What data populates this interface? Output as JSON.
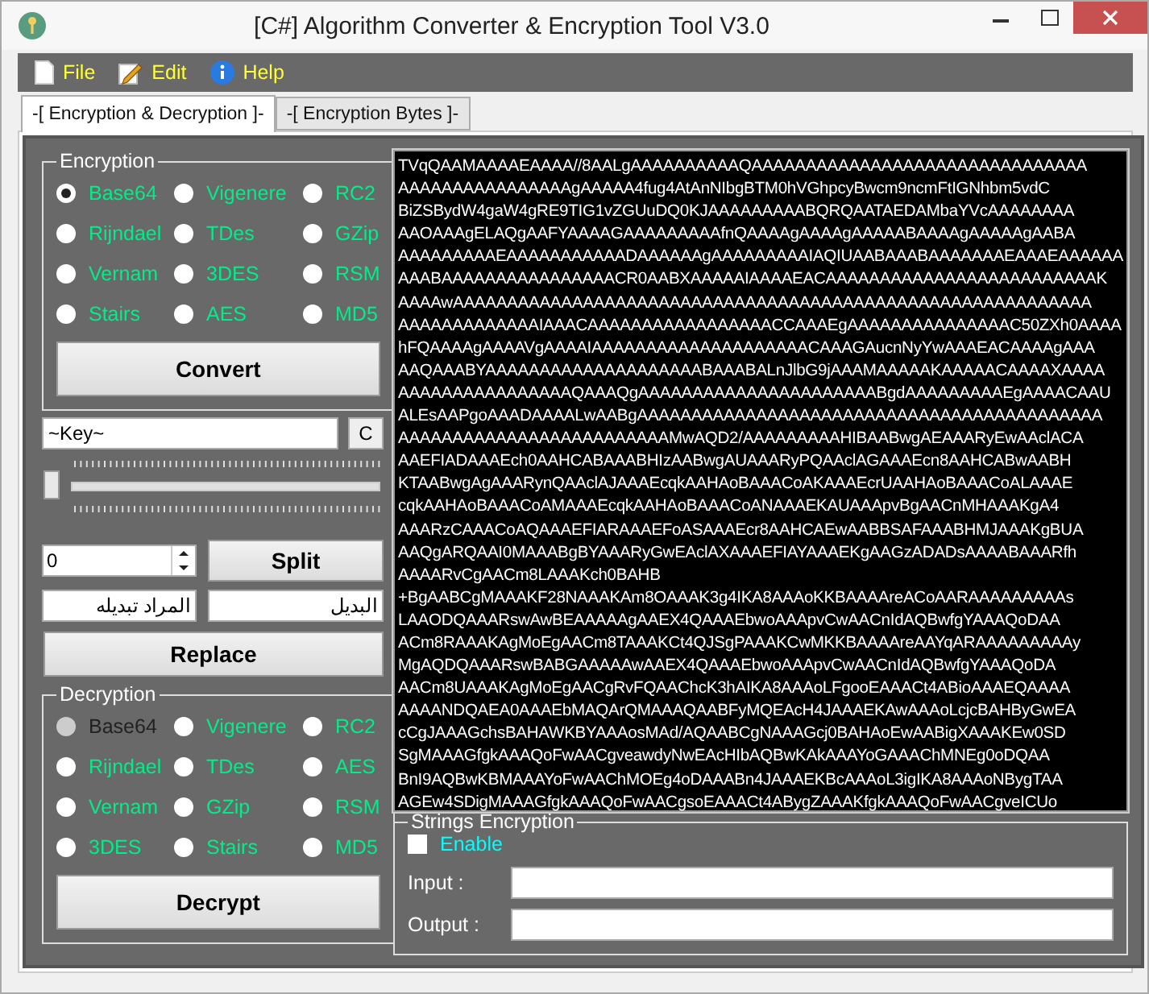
{
  "window": {
    "title": "[C#] Algorithm Converter & Encryption Tool V3.0"
  },
  "menu": [
    {
      "label": "File",
      "kind": "file"
    },
    {
      "label": "Edit",
      "kind": "edit"
    },
    {
      "label": "Help",
      "kind": "help"
    }
  ],
  "tabs": [
    {
      "label": "-[ Encryption & Decryption ]-",
      "selected": true
    },
    {
      "label": "-[ Encryption Bytes ]-",
      "selected": false
    }
  ],
  "encryption": {
    "title": "Encryption",
    "button": "Convert",
    "options": [
      {
        "label": "Base64",
        "selected": true,
        "disabled": false
      },
      {
        "label": "Vigenere",
        "selected": false,
        "disabled": false
      },
      {
        "label": "RC2",
        "selected": false,
        "disabled": false
      },
      {
        "label": "Rijndael",
        "selected": false,
        "disabled": false
      },
      {
        "label": "TDes",
        "selected": false,
        "disabled": false
      },
      {
        "label": "GZip",
        "selected": false,
        "disabled": false
      },
      {
        "label": "Vernam",
        "selected": false,
        "disabled": false
      },
      {
        "label": "3DES",
        "selected": false,
        "disabled": false
      },
      {
        "label": "RSM",
        "selected": false,
        "disabled": false
      },
      {
        "label": "Stairs",
        "selected": false,
        "disabled": false
      },
      {
        "label": "AES",
        "selected": false,
        "disabled": false
      },
      {
        "label": "MD5",
        "selected": false,
        "disabled": false
      }
    ]
  },
  "key": {
    "value": "~Key~",
    "button": "C"
  },
  "slider": {
    "level": 0
  },
  "split": {
    "value": "0",
    "button": "Split"
  },
  "replace": {
    "find": "المراد تبديله",
    "with": "البديل",
    "button": "Replace"
  },
  "decryption": {
    "title": "Decryption",
    "button": "Decrypt",
    "options": [
      {
        "label": "Base64",
        "selected": false,
        "disabled": true
      },
      {
        "label": "Vigenere",
        "selected": false,
        "disabled": false
      },
      {
        "label": "RC2",
        "selected": false,
        "disabled": false
      },
      {
        "label": "Rijndael",
        "selected": false,
        "disabled": false
      },
      {
        "label": "TDes",
        "selected": false,
        "disabled": false
      },
      {
        "label": "AES",
        "selected": false,
        "disabled": false
      },
      {
        "label": "Vernam",
        "selected": false,
        "disabled": false
      },
      {
        "label": "GZip",
        "selected": false,
        "disabled": false
      },
      {
        "label": "RSM",
        "selected": false,
        "disabled": false
      },
      {
        "label": "3DES",
        "selected": false,
        "disabled": false
      },
      {
        "label": "Stairs",
        "selected": false,
        "disabled": false
      },
      {
        "label": "MD5",
        "selected": false,
        "disabled": false
      }
    ]
  },
  "output": {
    "lines": [
      "TVqQAAMAAAAEAAAA//8AALgAAAAAAAAAAQAAAAAAAAAAAAAAAAAAAAAAAAAAAAAAA",
      "AAAAAAAAAAAAAAAAgAAAAA4fug4AtAnNIbgBTM0hVGhpcyBwcm9ncmFtIGNhbm5vdC",
      "BiZSBydW4gaW4gRE9TIG1vZGUuDQ0KJAAAAAAAAABQRQAATAEDAMbaYVcAAAAAAAA",
      "AAOAAAgELAQgAAFYAAAAGAAAAAAAAAfnQAAAAgAAAAgAAAAABAAAAgAAAAAgAABA",
      "AAAAAAAAAEAAAAAAAAAAADAAAAAAgAAAAAAAAAIAQIUAABAAABAAAAAAAEAAAEAAAAAA",
      "AAABAAAAAAAAAAAAAAAACR0AABXAAAAAIAAAAEACAAAAAAAAAAAAAAAAAAAAAAAAAK",
      "AAAAwAAAAAAAAAAAAAAAAAAAAAAAAAAAAAAAAAAAAAAAAAAAAAAAAAAAAAAAAAAA",
      "AAAAAAAAAAAAAIAAACAAAAAAAAAAAAAAAAACCAAAEgAAAAAAAAAAAAAAAC50ZXh0AAAA",
      "hFQAAAAgAAAAVgAAAAIAAAAAAAAAAAAAAAAAAAACAAAGAucnNyYwAAAEACAAAAgAAA",
      "AAQAAABYAAAAAAAAAAAAAAAAAAAABAAABALnJlbG9jAAAMAAAAAKAAAAACAAAAXAAAA",
      "AAAAAAAAAAAAAAAAQAAAQgAAAAAAAAAAAAAAAAAAAAAABgdAAAAAAAAAEgAAAACAAU",
      "ALEsAAPgoAAADAAAALwAABgAAAAAAAAAAAAAAAAAAAAAAAAAAAAAAAAAAAAAAAAAAA",
      "AAAAAAAAAAAAAAAAAAAAAAAAAMwAQD2/AAAAAAAAAHIBAABwgAEAAARyEwAAclACA",
      "AAEFIADAAAEch0AAHCABAAABHIzAABwgAUAAARyPQAAclAGAAAEcn8AAHCABwAABH",
      "KTAABwgAgAAARynQAAclAJAAAEcqkAAHAoBAAACoAKAAAEcrUAAHAoBAAACoALAAAE",
      "cqkAAHAoBAAACoAMAAAEcqkAAHAoBAAACoANAAAEKAUAAApvBgAACnMHAAAKgA4",
      "AAARzCAAACoAQAAAEFIARAAAEFoASAAAEcr8AAHCAEwAABBSAFAAABHMJAAAKgBUA",
      "AAQgARQAAI0MAAABgBYAAARyGwEAclAXAAAEFIAYAAAEKgAAGzADADsAAAABAAARfh",
      "AAAARvCgAACm8LAAAKch0BAHB",
      "+BgAABCgMAAAKF28NAAAKAm8OAAAK3g4IKA8AAAoKKBAAAAreACoAARAAAAAAAAAs",
      "LAAODQAAARswAwBEAAAAAgAAEX4QAAAEbwoAAApvCwAACnIdAQBwfgYAAAQoDAA",
      "ACm8RAAAKAgMoEgAACm8TAAAKCt4QJSgPAAAKCwMKKBAAAAreAAYqARAAAAAAAAAy",
      "MgAQDQAAARswBABGAAAAAwAAEX4QAAAEbwoAAApvCwAACnIdAQBwfgYAAAQoDA",
      "AACm8UAAAKAgMoEgAACgRvFQAAChcK3hAIKA8AAAoLFgooEAAACt4ABioAAAEQAAAA",
      "AAAANDQAEA0AAAEbMAQArQMAAAQAABFyMQEAcH4JAAAEKAwAAAoLcjcBAHByGwEA",
      "cCgJAAAGchsBAHAWKBYAAAosMAd/AQAABCgNAAAGcj0BAHAoEwAABigXAAAKEw0SD",
      "SgMAAAGfgkAAAQoFwAACgveawdyNwEAcHIbAQBwKAkAAAYoGAAAChMNEg0oDQAA",
      "BnI9AQBwKBMAAAYoFwAAChMOEg4oDAAABn4JAAAEKBcAAAoL3igIKA8AAAoNBygTAA",
      "AGEw4SDigMAAAGfgkAAAQoFwAACgsoEAAACt4ABygZAAAKfgkAAAQoFwAACgveICUo"
    ]
  },
  "strings_encryption": {
    "title": "Strings Encryption",
    "enable": {
      "label": "Enable",
      "checked": false
    },
    "input_label": "Input :",
    "output_label": "Output :"
  }
}
